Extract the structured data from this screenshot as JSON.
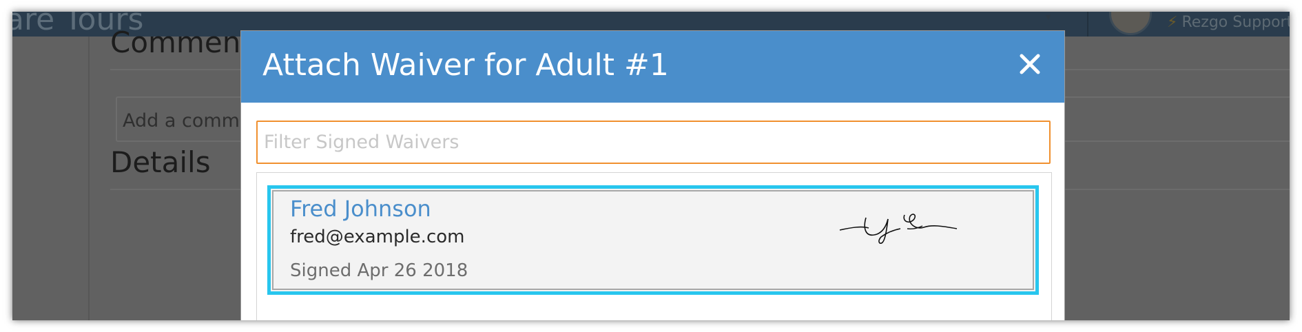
{
  "background": {
    "brand_text": "are Tours",
    "user_name": "Rezgo Support",
    "sections": [
      {
        "heading": "Comments"
      },
      {
        "heading": "Details"
      }
    ],
    "comment_placeholder": "Add a comment..."
  },
  "modal": {
    "title": "Attach Waiver for Adult #1",
    "close_icon": "close-icon",
    "filter_placeholder": "Filter Signed Waivers",
    "waivers": [
      {
        "name": "Fred Johnson",
        "email": "fred@example.com",
        "signed": "Signed Apr 26 2018"
      }
    ]
  },
  "colors": {
    "header": "#4a8ecb",
    "filter_border": "#f0902e",
    "selection": "#28c6ee",
    "link": "#4a8ecb"
  }
}
